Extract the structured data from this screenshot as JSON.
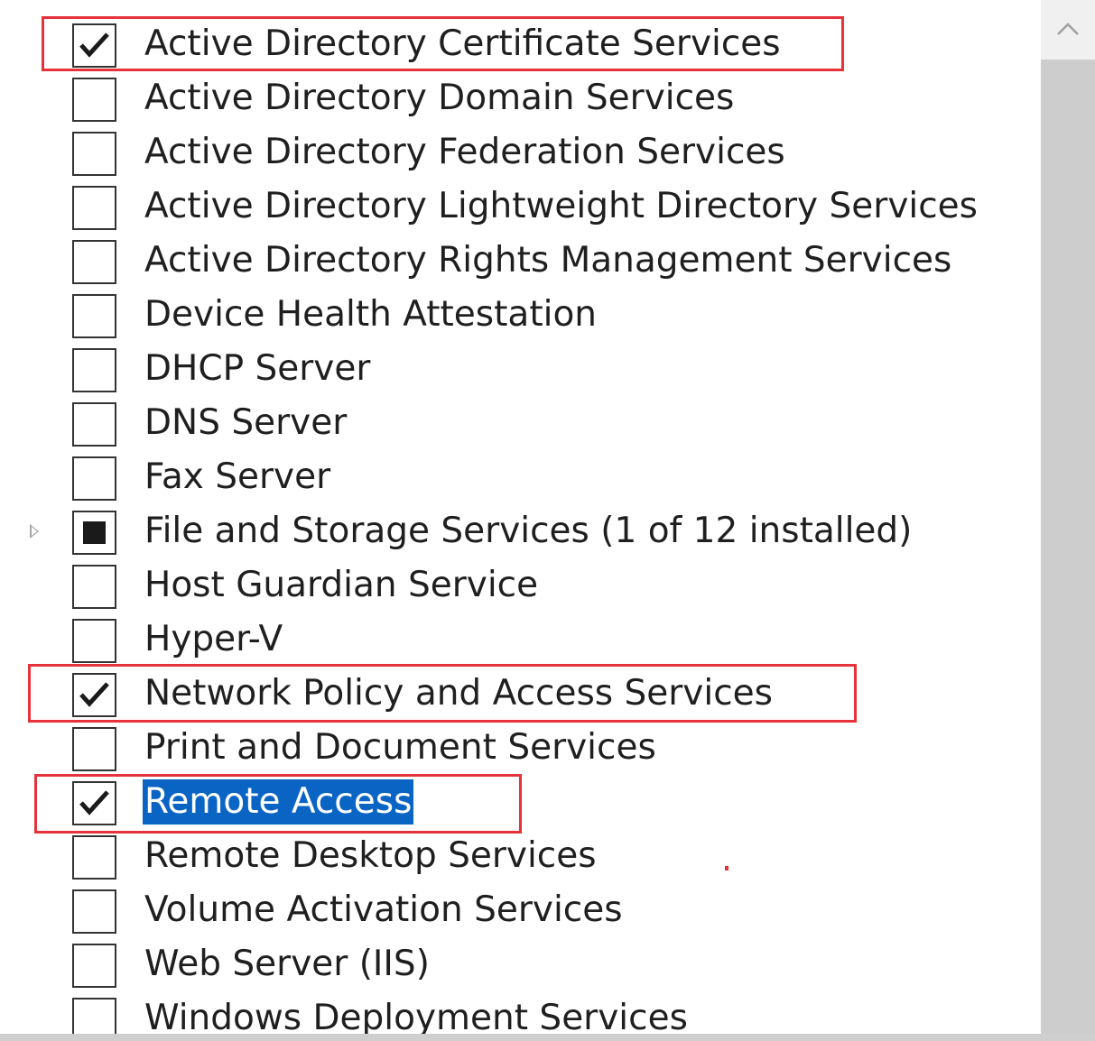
{
  "roles": [
    {
      "label": "Active Directory Certificate Services",
      "state": "checked"
    },
    {
      "label": "Active Directory Domain Services",
      "state": "unchecked"
    },
    {
      "label": "Active Directory Federation Services",
      "state": "unchecked"
    },
    {
      "label": "Active Directory Lightweight Directory Services",
      "state": "unchecked"
    },
    {
      "label": "Active Directory Rights Management Services",
      "state": "unchecked"
    },
    {
      "label": "Device Health Attestation",
      "state": "unchecked"
    },
    {
      "label": "DHCP Server",
      "state": "unchecked"
    },
    {
      "label": "DNS Server",
      "state": "unchecked"
    },
    {
      "label": "Fax Server",
      "state": "unchecked"
    },
    {
      "label": "File and Storage Services (1 of 12 installed)",
      "state": "partial",
      "expandable": true
    },
    {
      "label": "Host Guardian Service",
      "state": "unchecked"
    },
    {
      "label": "Hyper-V",
      "state": "unchecked"
    },
    {
      "label": "Network Policy and Access Services",
      "state": "checked"
    },
    {
      "label": "Print and Document Services",
      "state": "unchecked"
    },
    {
      "label": "Remote Access",
      "state": "checked",
      "selected": true
    },
    {
      "label": "Remote Desktop Services",
      "state": "unchecked"
    },
    {
      "label": "Volume Activation Services",
      "state": "unchecked"
    },
    {
      "label": "Web Server (IIS)",
      "state": "unchecked"
    },
    {
      "label": "Windows Deployment Services",
      "state": "unchecked"
    }
  ],
  "colors": {
    "selection": "#0a64c4",
    "highlight_box": "#e5323b",
    "scrollbar_track": "#f0f0f0",
    "scrollbar_thumb": "#cdcdcd"
  },
  "icons": {
    "scroll_up": "chevron-up-icon",
    "expander": "triangle-right-icon",
    "check": "check-icon"
  }
}
